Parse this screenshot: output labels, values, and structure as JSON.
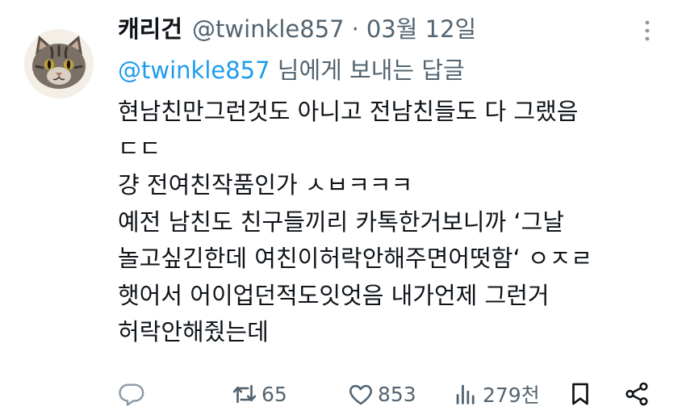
{
  "tweet": {
    "author_name": "캐리건",
    "handle": "@twinkle857",
    "separator": "·",
    "date": "03월 12일",
    "reply_to_mention": "@twinkle857",
    "reply_to_suffix": " 님에게 보내는 답글",
    "body_lines": [
      "현남친만그런것도 아니고 전남친들도 다 그랬음",
      "ㄷㄷ",
      "걍 전여친작품인가 ㅅㅂㅋㅋㅋ",
      "예전 남친도 친구들끼리 카톡한거보니까 ‘그날",
      "놀고싶긴한데 여친이허락안해주면어떳함‘ ㅇㅈㄹ",
      "햇어서 어이업던적도잇엇음 내가언제 그런거",
      "허락안해줬는데"
    ]
  },
  "actions": {
    "reply_count": "",
    "retweet_count": "65",
    "like_count": "853",
    "views_count": "279천"
  },
  "icons": {
    "avatar": "cat-photo-avatar",
    "more": "more-vertical-icon",
    "reply": "reply-icon",
    "retweet": "retweet-icon",
    "like": "heart-icon",
    "views": "views-icon",
    "bookmark": "bookmark-icon",
    "share": "share-icon"
  },
  "colors": {
    "text": "#0f1419",
    "secondary": "#536471",
    "accent": "#1d9bf0"
  }
}
